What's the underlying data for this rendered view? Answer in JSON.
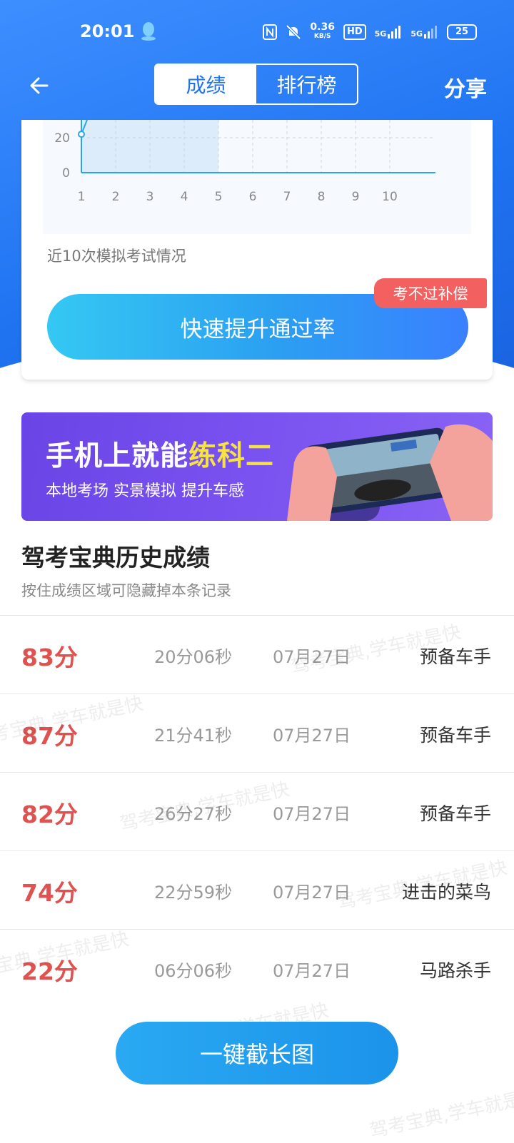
{
  "status_bar": {
    "time": "20:01",
    "net_speed_value": "0.36",
    "net_speed_unit": "KB/S",
    "hd_label": "HD",
    "signal_1": "5G",
    "signal_2": "5G",
    "battery": "25"
  },
  "header": {
    "tabs": [
      {
        "label": "成绩",
        "active": true
      },
      {
        "label": "排行榜",
        "active": false
      }
    ],
    "share_label": "分享"
  },
  "score_chart": {
    "note": "近10次模拟考试情况",
    "boost_button": "快速提升通过率",
    "boost_tag": "考不过补偿"
  },
  "chart_data": {
    "type": "line",
    "x": [
      1,
      2,
      3,
      4,
      5,
      6,
      7,
      8,
      9,
      10
    ],
    "x_tick_labels": [
      "1",
      "2",
      "3",
      "4",
      "5",
      "6",
      "7",
      "8",
      "9",
      "10"
    ],
    "y_tick_labels": [
      "20",
      "0"
    ],
    "visible_points": [
      {
        "x": 1,
        "y": 22
      }
    ],
    "highlight_range": [
      1,
      5
    ],
    "grid": true,
    "colors": {
      "line": "#29a6e8",
      "highlight": "#dcecfb",
      "axis": "#29a6e8"
    }
  },
  "banner": {
    "title_main": "手机上就能",
    "title_highlight": "练科二",
    "subtitle": "本地考场 实景模拟 提升车感"
  },
  "history": {
    "title": "驾考宝典历史成绩",
    "hint": "按住成绩区域可隐藏掉本条记录",
    "rows": [
      {
        "score": "83分",
        "duration": "20分06秒",
        "date": "07月27日",
        "rank": "预备车手"
      },
      {
        "score": "87分",
        "duration": "21分41秒",
        "date": "07月27日",
        "rank": "预备车手"
      },
      {
        "score": "82分",
        "duration": "26分27秒",
        "date": "07月27日",
        "rank": "预备车手"
      },
      {
        "score": "74分",
        "duration": "22分59秒",
        "date": "07月27日",
        "rank": "进击的菜鸟"
      },
      {
        "score": "22分",
        "duration": "06分06秒",
        "date": "07月27日",
        "rank": "马路杀手"
      }
    ]
  },
  "watermark_text": "驾考宝典,学车就是快",
  "screenshot_button": "一键截长图",
  "colors": {
    "brand_blue": "#1f72f0",
    "score_red": "#e0524f",
    "tag_red": "#f26060",
    "banner_purple": "#7a52f0",
    "banner_highlight": "#f4e341"
  }
}
